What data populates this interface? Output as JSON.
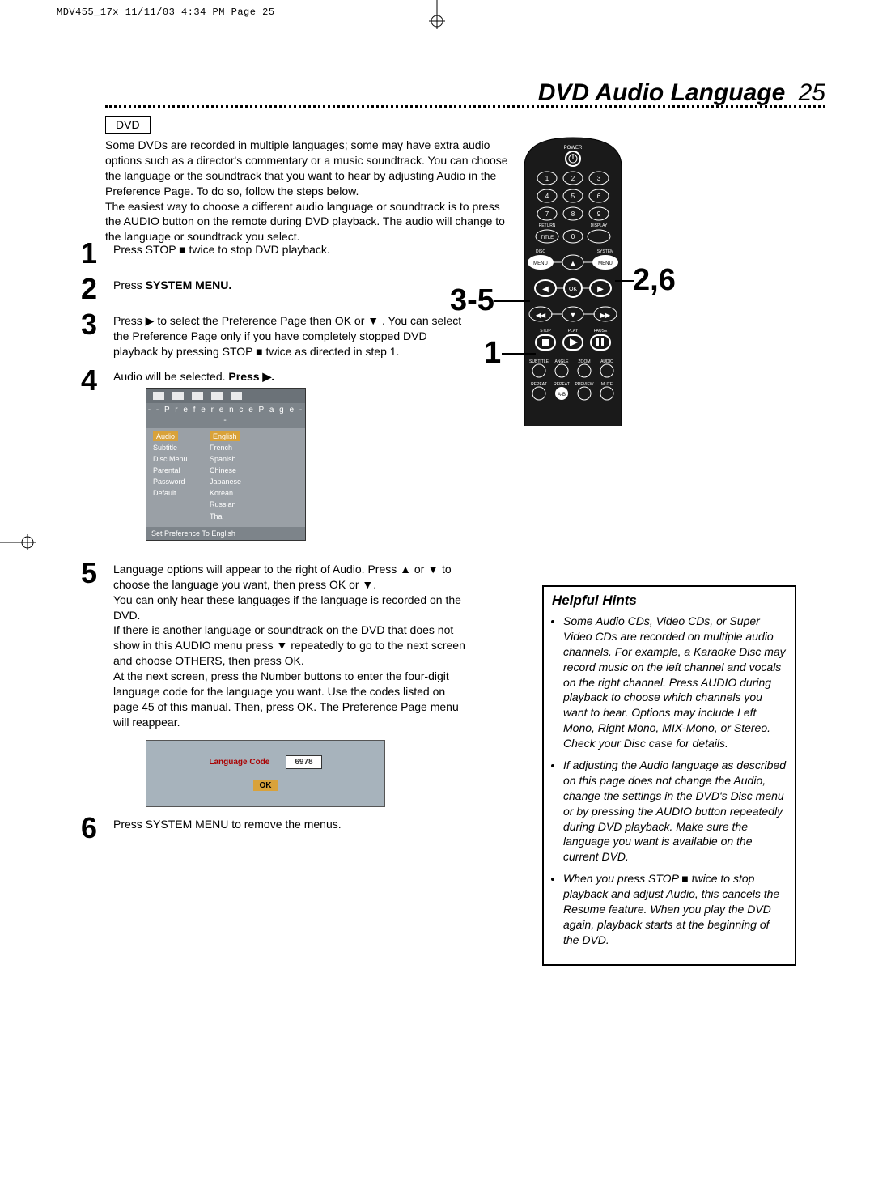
{
  "meta_line": "MDV455_17x  11/11/03  4:34 PM  Page 25",
  "title": "DVD Audio Language",
  "page_number": "25",
  "dvd_badge": "DVD",
  "intro_p1": "Some DVDs are recorded in multiple languages; some may have extra audio options such as a director's commentary or a music soundtrack. You can choose the language or the soundtrack that you want to hear by adjusting Audio in the Preference Page.  To do so, follow the steps below.",
  "intro_p2": "The easiest way to choose a different audio language or soundtrack is to press the AUDIO button on the remote during DVD playback. The audio will change to the language or soundtrack you select.",
  "steps": {
    "s1": "Press STOP ■ twice to stop DVD playback.",
    "s2a": "Press ",
    "s2b": "SYSTEM MENU.",
    "s3": "Press ▶ to select the Preference Page then OK or ▼ .  You can select the Preference Page only if you have completely stopped DVD playback by pressing STOP ■ twice as directed in step 1.",
    "s4a": "Audio will be selected. ",
    "s4b": "Press ▶.",
    "s5p1": "Language options will appear to the right of Audio. Press ▲ or ▼ to choose the language you want, then press OK or ▼.",
    "s5p2": "You can only hear these languages if the language is recorded on the DVD.",
    "s5p3": "If there is another language or soundtrack on the DVD that does not show in this AUDIO menu press ▼ repeatedly to go to the next screen and choose OTHERS, then press OK.",
    "s5p4": "At the next screen, press the Number buttons to enter the four-digit language code for the language you want. Use the codes listed on page 45 of this manual. Then, press OK. The Preference Page menu will reappear.",
    "s6": "Press SYSTEM MENU to remove the menus."
  },
  "pref": {
    "title": "- -   P r e f e r e n c e   P a g e   - -",
    "left": [
      "Audio",
      "Subtitle",
      "Disc Menu",
      "Parental",
      "Password",
      "Default"
    ],
    "right": [
      "English",
      "French",
      "Spanish",
      "Chinese",
      "Japanese",
      "Korean",
      "Russian",
      "Thai"
    ],
    "foot": "Set Preference To English"
  },
  "langcode": {
    "label": "Language Code",
    "value": "6978",
    "ok": "OK"
  },
  "callouts": {
    "a": "3-5",
    "b": "2,6",
    "c": "1"
  },
  "remote": {
    "power": "POWER",
    "nums": [
      "1",
      "2",
      "3",
      "4",
      "5",
      "6",
      "7",
      "8",
      "9",
      "0"
    ],
    "return": "RETURN",
    "display": "DISPLAY",
    "title": "TITLE",
    "disc_menu": "DISC\nMENU",
    "system_menu": "SYSTEM\nMENU",
    "menu_l": "MENU",
    "menu_r": "MENU",
    "ok": "OK",
    "stop": "STOP",
    "play": "PLAY",
    "pause": "PAUSE",
    "row_a": [
      "SUBTITLE",
      "ANGLE",
      "ZOOM",
      "AUDIO"
    ],
    "row_b": [
      "REPEAT",
      "REPEAT\nA-B",
      "PREVIEW",
      "MUTE"
    ]
  },
  "hints": {
    "title": "Helpful Hints",
    "items": [
      "Some Audio CDs, Video CDs, or Super Video CDs are recorded on multiple audio channels. For example, a Karaoke Disc may record music on the left channel and vocals on the right channel. Press AUDIO during playback to choose which channels you want to hear. Options may include Left Mono, Right Mono, MIX-Mono, or Stereo. Check your Disc case for details.",
      "If adjusting the Audio language as described on this page does not change the Audio, change the settings in the DVD's Disc menu or by pressing the AUDIO button repeatedly during DVD playback. Make sure the language you want is available on the current DVD.",
      "When you press STOP ■ twice to stop playback and adjust Audio, this cancels the Resume feature. When you play the DVD again, playback starts at the beginning of the DVD."
    ]
  }
}
